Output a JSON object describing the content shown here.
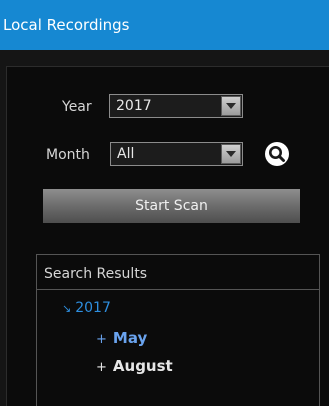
{
  "window": {
    "title": "Local Recordings"
  },
  "filters": {
    "year_label": "Year",
    "year_value": "2017",
    "month_label": "Month",
    "month_value": "All"
  },
  "actions": {
    "scan_label": "Start Scan"
  },
  "results": {
    "header": "Search Results",
    "tree": {
      "year": {
        "expand_glyph": "↘",
        "label": "2017"
      },
      "months": [
        {
          "expand_glyph": "+",
          "label": "May",
          "color": "#6aa3ee"
        },
        {
          "expand_glyph": "+",
          "label": "August",
          "color": "#e6e6e6"
        }
      ]
    }
  },
  "colors": {
    "title_bar": "#1688d2",
    "tree_year": "#2e8fe0",
    "selected_month": "#6aa3ee"
  },
  "icons": {
    "search": "search-icon",
    "dropdown": "chevron-down-icon"
  }
}
